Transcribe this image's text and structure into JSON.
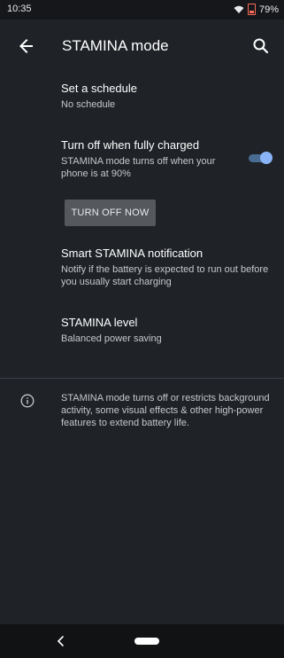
{
  "status": {
    "time": "10:35",
    "battery": "79%"
  },
  "appbar": {
    "title": "STAMINA mode"
  },
  "settings": {
    "schedule": {
      "title": "Set a schedule",
      "subtitle": "No schedule"
    },
    "turn_off_charged": {
      "title": "Turn off when fully charged",
      "subtitle": "STAMINA mode turns off when your phone is at 90%",
      "enabled": true
    },
    "turn_off_now_label": "TURN OFF NOW",
    "smart_notification": {
      "title": "Smart STAMINA notification",
      "subtitle": "Notify if the battery is expected to run out before you usually start charging"
    },
    "level": {
      "title": "STAMINA level",
      "subtitle": "Balanced power saving"
    }
  },
  "info": {
    "text": "STAMINA mode turns off or restricts background activity, some visual effects & other high-power features to extend battery life."
  },
  "icons": {
    "back": "arrow-back-icon",
    "search": "search-icon",
    "info": "info-icon",
    "wifi": "wifi-icon",
    "battery": "battery-icon",
    "nav_back": "chevron-left-icon",
    "nav_home": "home-pill-icon"
  },
  "colors": {
    "background": "#1f2227",
    "accent": "#8ab4f8",
    "battery_low": "#ff6b5a"
  }
}
